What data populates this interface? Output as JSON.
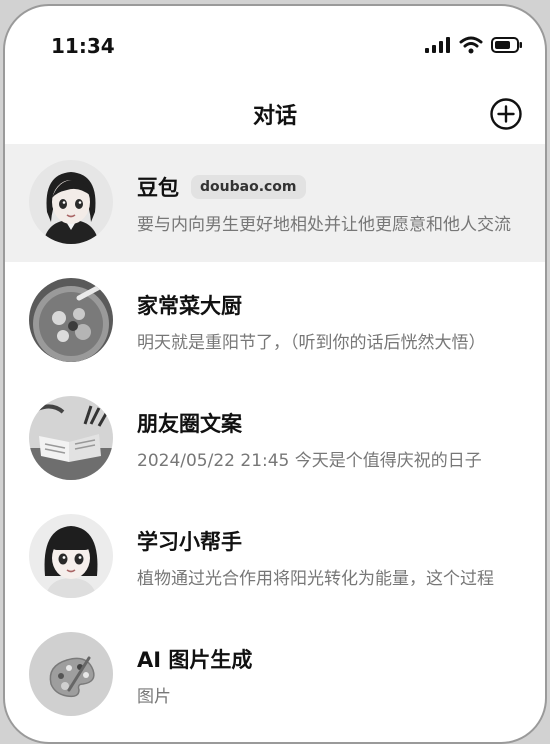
{
  "status_bar": {
    "time": "11:34",
    "icons": [
      "signal-icon",
      "wifi-icon",
      "battery-icon"
    ]
  },
  "header": {
    "title": "对话",
    "action_icon": "plus-circle-icon"
  },
  "conversations": [
    {
      "name": "豆包",
      "badge": "doubao.com",
      "preview": "要与内向男生更好地相处并让他更愿意和他人交流",
      "avatar": "cartoon-girl-avatar",
      "selected": true
    },
    {
      "name": "家常菜大厨",
      "preview": "明天就是重阳节了，（听到你的话后恍然大悟）",
      "avatar": "food-dish-avatar"
    },
    {
      "name": "朋友圈文案",
      "preview": "2024/05/22 21:45 今天是个值得庆祝的日子",
      "avatar": "scenery-book-avatar"
    },
    {
      "name": "学习小帮手",
      "preview": "植物通过光合作用将阳光转化为能量，这个过程",
      "avatar": "cartoon-girl-bangs-avatar"
    },
    {
      "name": "AI 图片生成",
      "preview": "图片",
      "avatar": "palette-avatar"
    }
  ]
}
